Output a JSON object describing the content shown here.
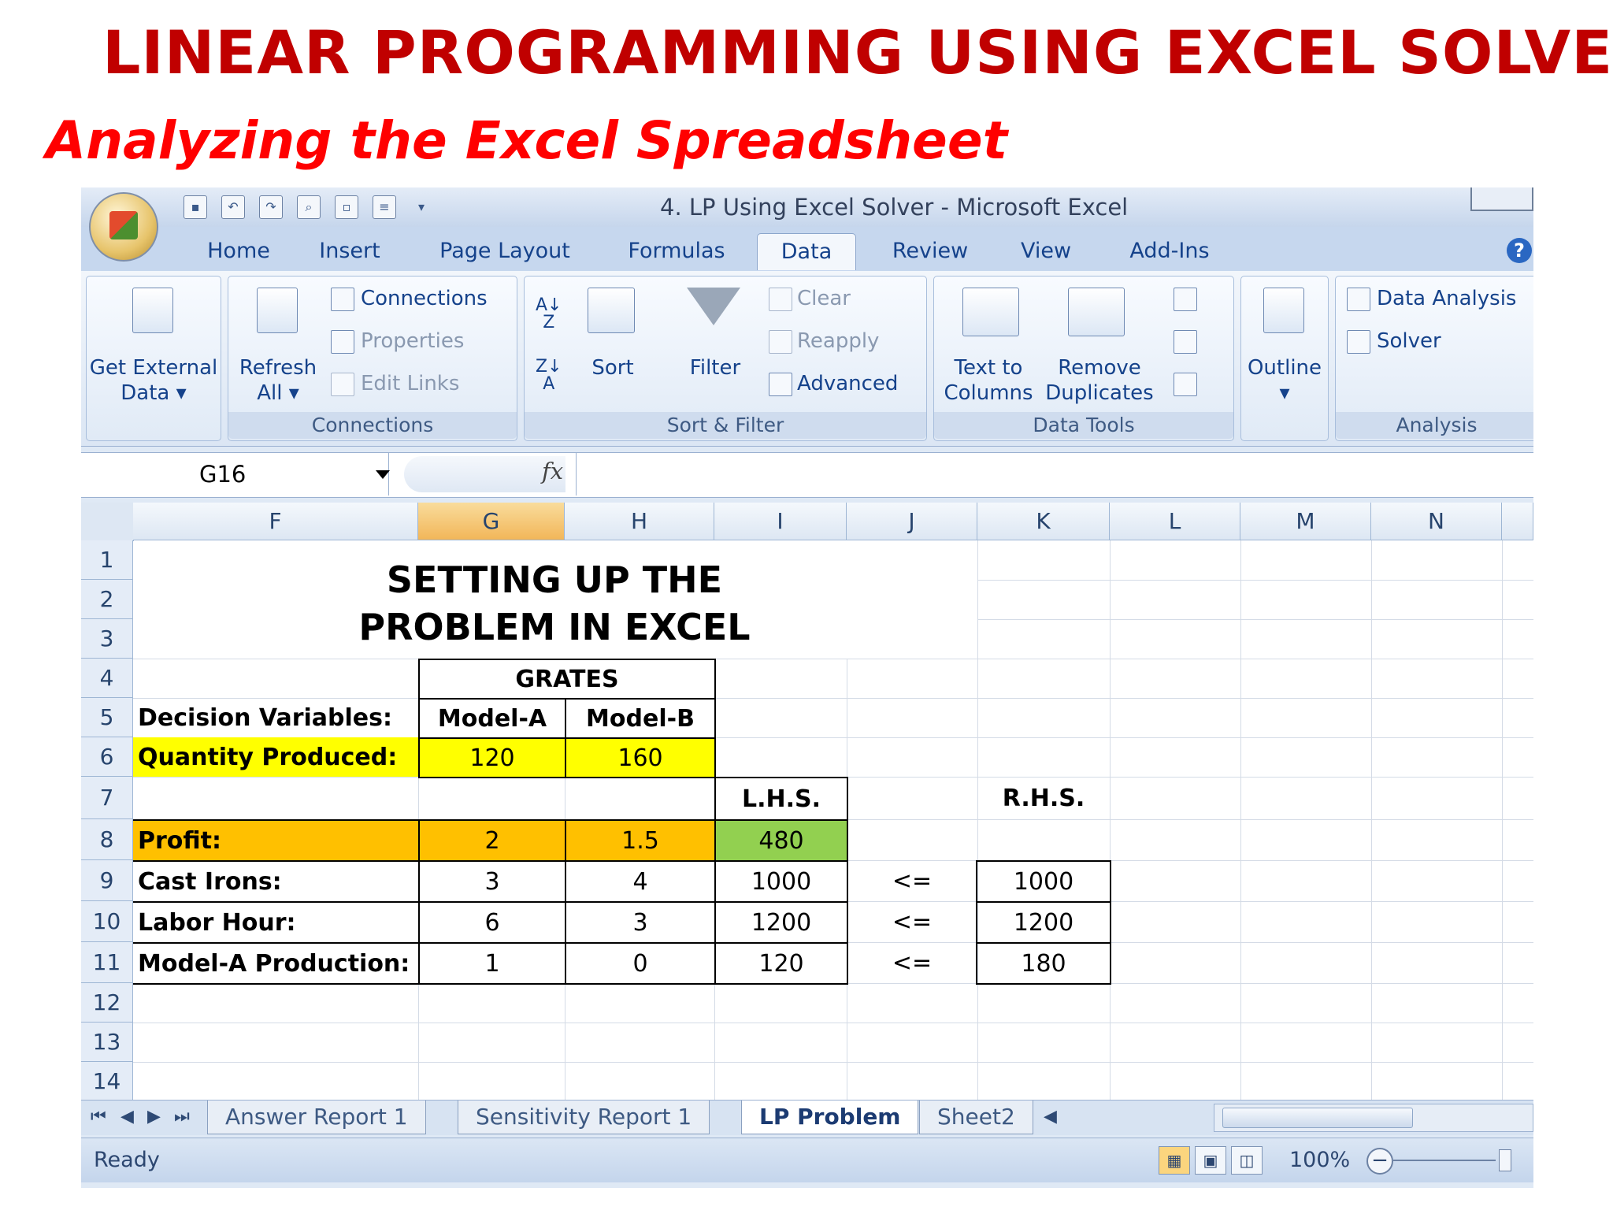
{
  "slide": {
    "title": "LINEAR PROGRAMMING USING EXCEL SOLVER",
    "subtitle": "Analyzing the Excel Spreadsheet"
  },
  "window": {
    "title": "4. LP Using Excel Solver - Microsoft Excel"
  },
  "tabs": [
    "Home",
    "Insert",
    "Page Layout",
    "Formulas",
    "Data",
    "Review",
    "View",
    "Add-Ins"
  ],
  "active_tab": "Data",
  "ribbon": {
    "get_external_line1": "Get External",
    "get_external_line2": "Data",
    "refresh_line1": "Refresh",
    "refresh_line2": "All",
    "connections": "Connections",
    "properties": "Properties",
    "edit_links": "Edit Links",
    "group_connections": "Connections",
    "sort": "Sort",
    "filter": "Filter",
    "clear": "Clear",
    "reapply": "Reapply",
    "advanced": "Advanced",
    "group_sort_filter": "Sort & Filter",
    "text_to_line1": "Text to",
    "text_to_line2": "Columns",
    "remove_line1": "Remove",
    "remove_line2": "Duplicates",
    "group_data_tools": "Data Tools",
    "outline": "Outline",
    "data_analysis": "Data Analysis",
    "solver": "Solver",
    "group_analysis": "Analysis"
  },
  "formula_bar": {
    "name_box": "G16",
    "fx": "fx",
    "formula": ""
  },
  "grid": {
    "columns": [
      "F",
      "G",
      "H",
      "I",
      "J",
      "K",
      "L",
      "M",
      "N"
    ],
    "selected_column": "G",
    "rows": [
      "1",
      "2",
      "3",
      "4",
      "5",
      "6",
      "7",
      "8",
      "9",
      "10",
      "11",
      "12",
      "13",
      "14"
    ],
    "heading_line1": "SETTING UP THE",
    "heading_line2": "PROBLEM IN EXCEL",
    "grates": "GRATES",
    "decision_variables": "Decision Variables:",
    "model_a": "Model-A",
    "model_b": "Model-B",
    "quantity_produced": "Quantity Produced:",
    "qty_a": "120",
    "qty_b": "160",
    "lhs": "L.H.S.",
    "rhs": "R.H.S.",
    "profit": "Profit:",
    "profit_a": "2",
    "profit_b": "1.5",
    "profit_lhs": "480",
    "cast_irons": "Cast Irons:",
    "cast_a": "3",
    "cast_b": "4",
    "cast_lhs": "1000",
    "cast_op": "<=",
    "cast_rhs": "1000",
    "labor_hour": "Labor Hour:",
    "labor_a": "6",
    "labor_b": "3",
    "labor_lhs": "1200",
    "labor_op": "<=",
    "labor_rhs": "1200",
    "model_a_production": "Model-A Production:",
    "prod_a": "1",
    "prod_b": "0",
    "prod_lhs": "120",
    "prod_op": "<=",
    "prod_rhs": "180"
  },
  "colors": {
    "yellow": "#ffff00",
    "orange": "#ffc000",
    "green": "#92d050",
    "title_red": "#c00000",
    "subtitle_red": "#ff0000"
  },
  "sheet_tabs": [
    "Answer Report 1",
    "Sensitivity Report 1",
    "LP Problem",
    "Sheet2"
  ],
  "active_sheet": "LP Problem",
  "status": {
    "text": "Ready",
    "zoom": "100%"
  }
}
